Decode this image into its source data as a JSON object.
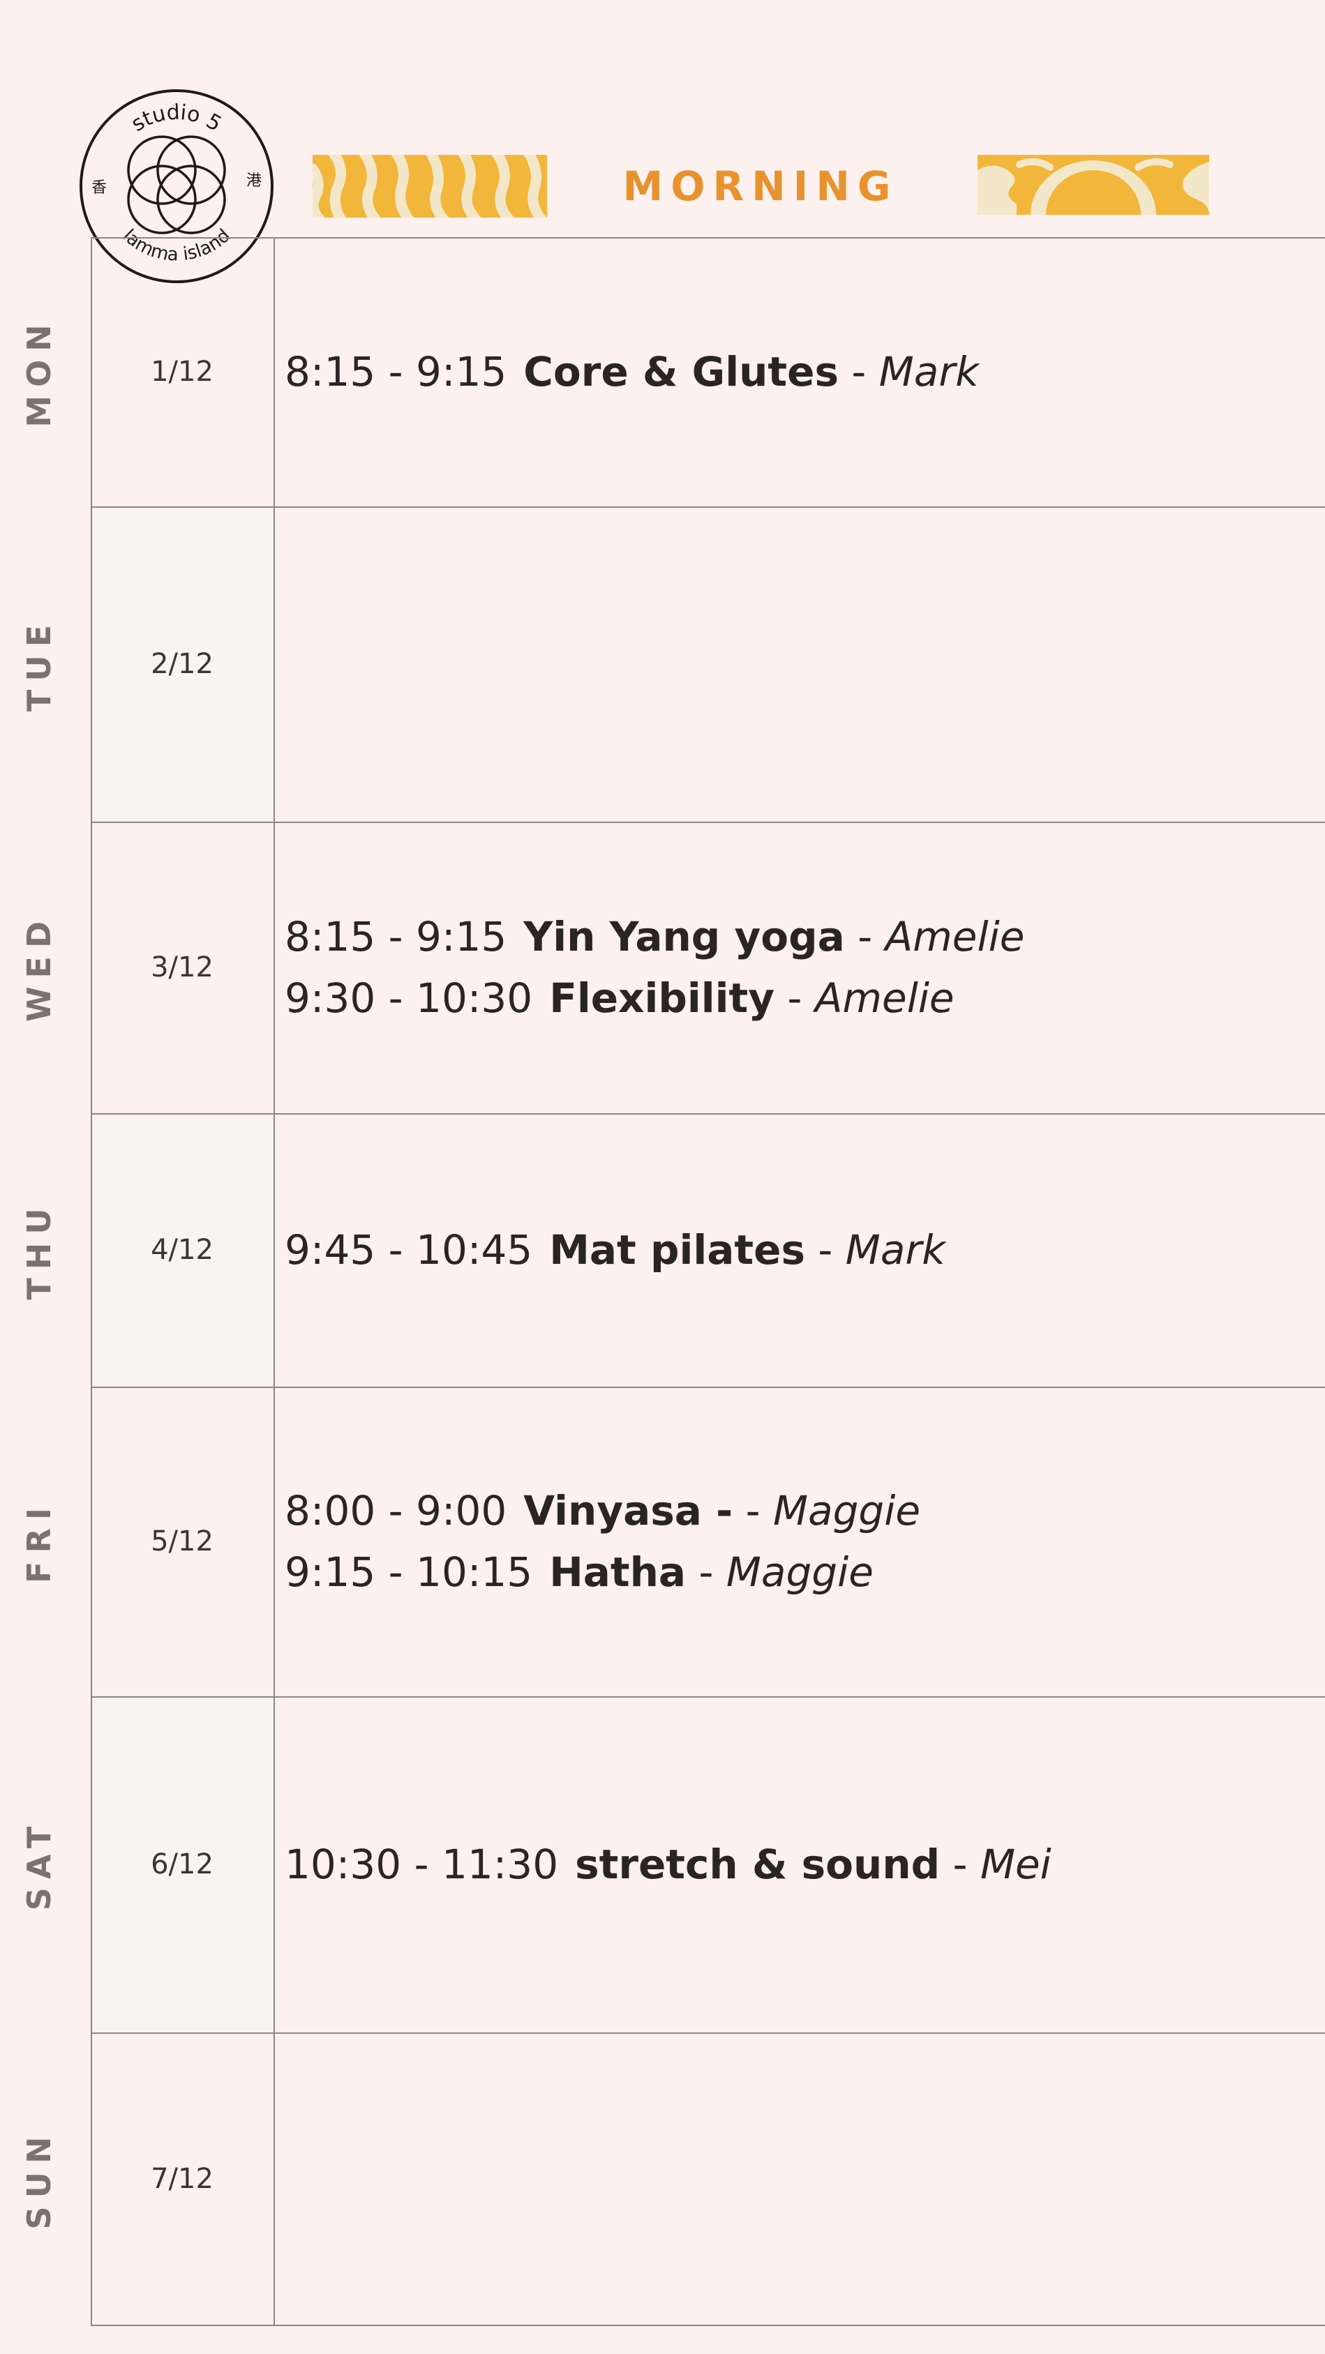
{
  "brand": {
    "name": "studio 5",
    "location": "lamma island",
    "chars_left": "香",
    "chars_right": "港"
  },
  "header": {
    "title": "MORNING"
  },
  "colors": {
    "background": "#fcf1ee",
    "accent_orange": "#e8922e",
    "banner_yellow": "#f2b63a",
    "banner_cream": "#f3e7c9",
    "grid_line": "#8c8686",
    "day_label": "#7b7270"
  },
  "days": [
    {
      "day": "MON",
      "date": "1/12",
      "classes": [
        {
          "time": "8:15 - 9:15",
          "name": "Core & Glutes",
          "separator": " - ",
          "teacher": "Mark"
        }
      ]
    },
    {
      "day": "TUE",
      "date": "2/12",
      "classes": []
    },
    {
      "day": "WED",
      "date": "3/12",
      "classes": [
        {
          "time": "8:15 - 9:15",
          "name": "Yin Yang yoga",
          "separator": " - ",
          "teacher": "Amelie"
        },
        {
          "time": "9:30 - 10:30",
          "name": "Flexibility",
          "separator": " - ",
          "teacher": "Amelie"
        }
      ]
    },
    {
      "day": "THU",
      "date": "4/12",
      "classes": [
        {
          "time": "9:45 - 10:45",
          "name": "Mat pilates",
          "separator": " - ",
          "teacher": "Mark"
        }
      ]
    },
    {
      "day": "FRI",
      "date": "5/12",
      "classes": [
        {
          "time": "8:00 - 9:00",
          "name": "Vinyasa -",
          "separator": " - ",
          "teacher": "Maggie"
        },
        {
          "time": "9:15 - 10:15",
          "name": "Hatha",
          "separator": " - ",
          "teacher": "Maggie"
        }
      ]
    },
    {
      "day": "SAT",
      "date": "6/12",
      "classes": [
        {
          "time": "10:30 - 11:30",
          "name": "stretch & sound",
          "separator": " - ",
          "teacher": "Mei"
        }
      ]
    },
    {
      "day": "SUN",
      "date": "7/12",
      "classes": []
    }
  ]
}
